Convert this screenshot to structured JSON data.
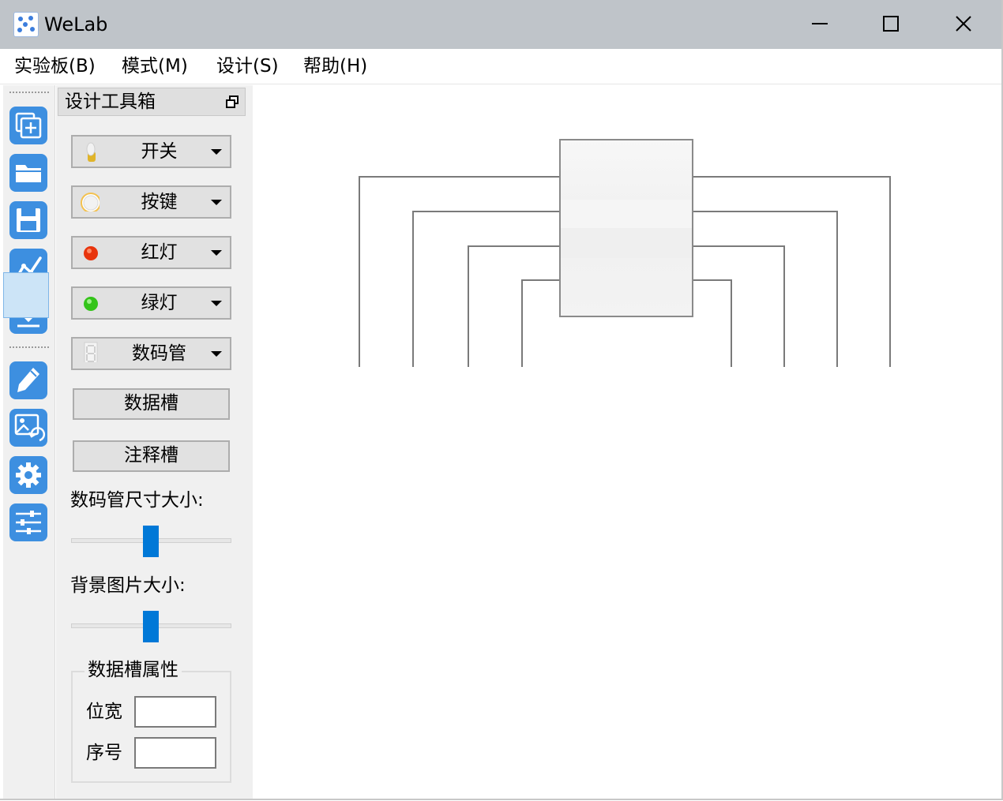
{
  "app": {
    "title": "WeLab"
  },
  "window_controls": {
    "minimize": "minimize-icon",
    "maximize": "maximize-icon",
    "close": "close-icon"
  },
  "menu": {
    "items": [
      {
        "label": "实验板(B)"
      },
      {
        "label": "模式(M)"
      },
      {
        "label": "设计(S)"
      },
      {
        "label": "帮助(H)"
      }
    ]
  },
  "toolbar": {
    "tools": [
      {
        "icon": "new-board-icon"
      },
      {
        "icon": "open-folder-icon"
      },
      {
        "icon": "save-icon"
      },
      {
        "icon": "waveform-icon"
      },
      {
        "icon": "download-icon"
      },
      {
        "icon": "pencil-icon",
        "active": true
      },
      {
        "icon": "image-import-icon"
      },
      {
        "icon": "settings-gear-icon"
      },
      {
        "icon": "sliders-icon"
      }
    ],
    "accent_color": "#3d8fe0"
  },
  "toolbox": {
    "title": "设计工具箱",
    "components": [
      {
        "label": "开关",
        "icon": "switch-icon"
      },
      {
        "label": "按键",
        "icon": "button-icon"
      },
      {
        "label": "红灯",
        "icon": "red-led-icon",
        "color": "#e8340c"
      },
      {
        "label": "绿灯",
        "icon": "green-led-icon",
        "color": "#34c41a"
      },
      {
        "label": "数码管",
        "icon": "seven-segment-icon"
      }
    ],
    "buttons": {
      "data_slot": "数据槽",
      "comment_slot": "注释槽"
    },
    "segment_size": {
      "label": "数码管尺寸大小:",
      "value_fraction": 0.5
    },
    "background_size": {
      "label": "背景图片大小:",
      "value_fraction": 0.5
    },
    "data_slot_properties": {
      "title": "数据槽属性",
      "bit_width_label": "位宽",
      "bit_width_value": "",
      "index_label": "序号",
      "index_value": ""
    },
    "slider_color": "#0078d7"
  }
}
